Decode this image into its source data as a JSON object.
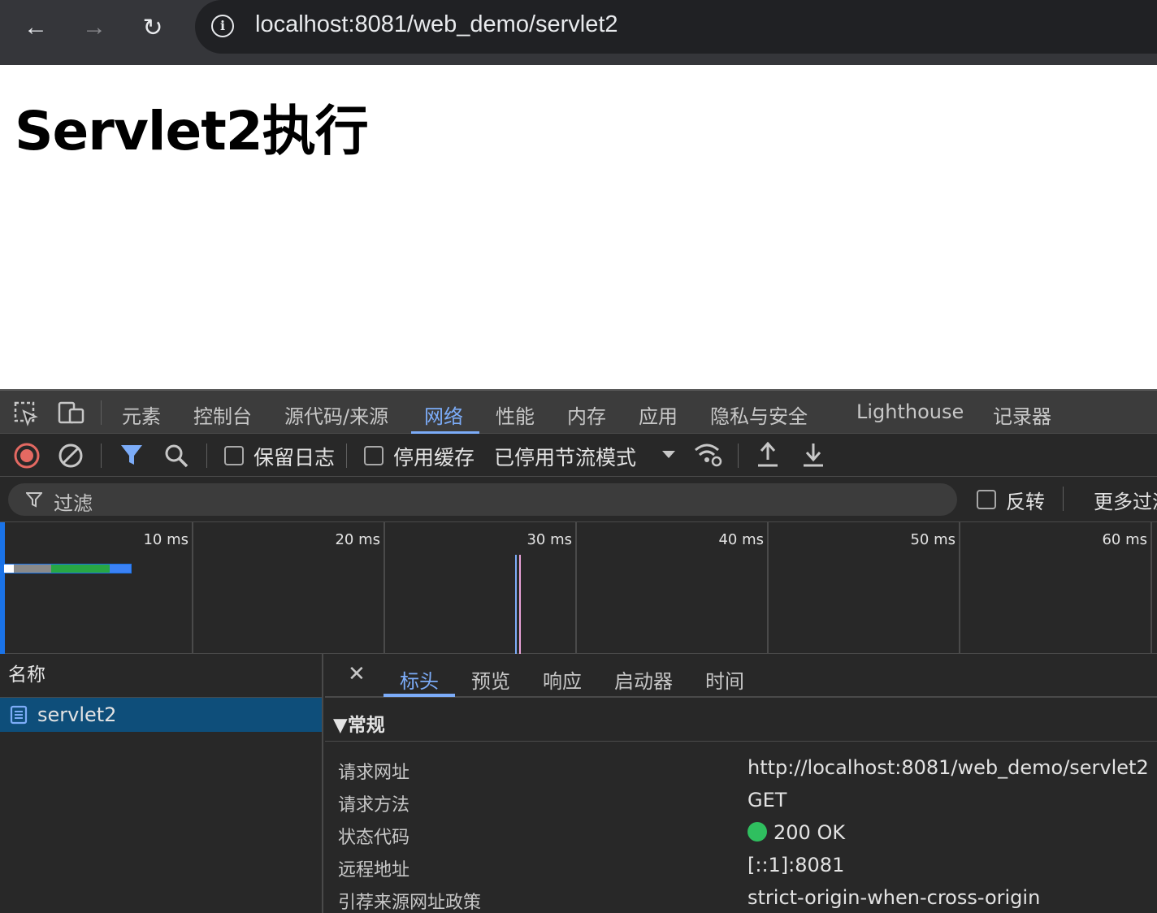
{
  "browser": {
    "url": "localhost:8081/web_demo/servlet2",
    "back_icon": "←",
    "forward_icon": "→",
    "reload_icon": "↻",
    "info_icon": "i"
  },
  "page": {
    "heading": "Servlet2执行"
  },
  "devtools": {
    "tabs": [
      "元素",
      "控制台",
      "源代码/来源",
      "网络",
      "性能",
      "内存",
      "应用",
      "隐私与安全",
      "Lighthouse",
      "记录器"
    ],
    "active_tab": "网络",
    "toolbar": {
      "preserve_log": "保留日志",
      "disable_cache": "停用缓存",
      "throttling": "已停用节流模式"
    },
    "filter": {
      "placeholder": "过滤",
      "invert": "反转",
      "more_filters": "更多过滤"
    },
    "timeline": {
      "ticks": [
        "10 ms",
        "20 ms",
        "30 ms",
        "40 ms",
        "50 ms",
        "60 ms"
      ]
    },
    "requests": {
      "column_header": "名称",
      "items": [
        "servlet2"
      ]
    },
    "details": {
      "close_icon": "✕",
      "tabs": [
        "标头",
        "预览",
        "响应",
        "启动器",
        "时间"
      ],
      "active_tab": "标头",
      "general": {
        "title": "▼常规",
        "rows": [
          {
            "key": "请求网址",
            "value": "http://localhost:8081/web_demo/servlet2"
          },
          {
            "key": "请求方法",
            "value": "GET"
          },
          {
            "key": "状态代码",
            "value": "200 OK"
          },
          {
            "key": "远程地址",
            "value": "[::1]:8081"
          },
          {
            "key": "引荐来源网址政策",
            "value": "strict-origin-when-cross-origin"
          }
        ]
      }
    }
  },
  "colors": {
    "accent": "#7cacf8",
    "record": "#e46962",
    "status_ok": "#2fbf5f",
    "selected_row": "#0e4e7a"
  }
}
